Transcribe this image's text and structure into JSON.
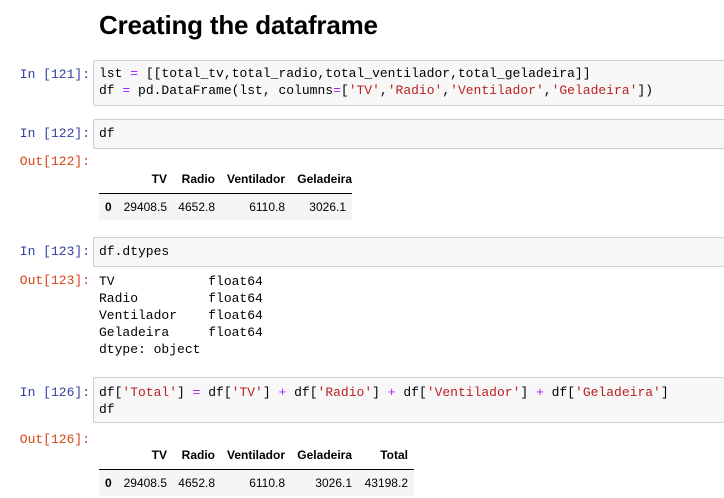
{
  "heading": "Creating the dataframe",
  "cells": [
    {
      "in_prompt": "In [121]:"
    },
    {
      "in_prompt": "In [122]:",
      "code": "df",
      "out_prompt": "Out[122]:"
    },
    {
      "in_prompt": "In [123]:",
      "code": "df.dtypes",
      "out_prompt": "Out[123]:"
    },
    {
      "in_prompt": "In [126]:",
      "out_prompt": "Out[126]:"
    }
  ],
  "code121": {
    "line1_a": "lst ",
    "line1_eq": "=",
    "line1_b": " [[total_tv,total_radio,total_ventilador,total_geladeira]]",
    "line2_a": "df ",
    "line2_eq": "=",
    "line2_b": " pd.DataFrame(lst, columns",
    "line2_eq2": "=",
    "line2_c": "[",
    "s_tv": "'TV'",
    "comma": ",",
    "s_radio": "'Radio'",
    "s_vent": "'Ventilador'",
    "s_gel": "'Geladeira'",
    "line2_end": "])"
  },
  "table122": {
    "columns": [
      "TV",
      "Radio",
      "Ventilador",
      "Geladeira"
    ],
    "rows": [
      {
        "index": "0",
        "values": [
          "29408.5",
          "4652.8",
          "6110.8",
          "3026.1"
        ]
      }
    ]
  },
  "dtypes": {
    "lines": [
      "TV            float64",
      "Radio         float64",
      "Ventilador    float64",
      "Geladeira     float64",
      "dtype: object"
    ]
  },
  "code126": {
    "p1": "df[",
    "s_total": "'Total'",
    "p2": "] ",
    "eq": "=",
    "p3": " df[",
    "s_tv": "'TV'",
    "p4": "] ",
    "plus": "+",
    "p5": " df[",
    "s_radio": "'Radio'",
    "s_vent": "'Ventilador'",
    "s_gel": "'Geladeira'",
    "close": "]",
    "line2": "df"
  },
  "table126": {
    "columns": [
      "TV",
      "Radio",
      "Ventilador",
      "Geladeira",
      "Total"
    ],
    "rows": [
      {
        "index": "0",
        "values": [
          "29408.5",
          "4652.8",
          "6110.8",
          "3026.1",
          "43198.2"
        ]
      }
    ]
  }
}
